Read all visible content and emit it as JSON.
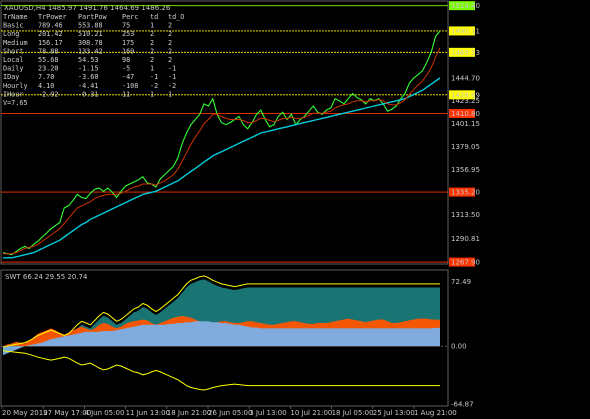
{
  "chart_data": [
    {
      "type": "line",
      "title": "XAUUSD,H4  1485.97 1491.76 1464.69 1486.26",
      "symbol": "XAUUSD,H4",
      "ohlc": {
        "open": "1485.97",
        "high": "1491.76",
        "low": "1464.69",
        "close": "1486.26"
      },
      "ylim": [
        1268,
        1516
      ],
      "y_ticks": [
        "1514.40",
        "1490.11",
        "1469.53",
        "1444.70",
        "1423.25",
        "1401.15",
        "1379.05",
        "1356.95",
        "1335.20",
        "1313.50",
        "1290.81",
        "1267.90"
      ],
      "y_tick_values": [
        1514.4,
        1490.11,
        1469.53,
        1444.7,
        1423.25,
        1401.15,
        1379.05,
        1356.95,
        1335.2,
        1313.5,
        1290.81,
        1267.9
      ],
      "highlighted_levels": [
        {
          "value": 1514.4,
          "label": "1514.40",
          "color": "#7CFC00"
        },
        {
          "value": 1490.11,
          "label": "1490.11",
          "color": "#ffff00"
        },
        {
          "value": 1469.53,
          "label": "1469.53",
          "color": "#ffff00"
        },
        {
          "value": 1428.69,
          "label": "1428.69",
          "color": "#ffff00"
        },
        {
          "value": 1410.8,
          "label": "1410.80",
          "color": "#ff3300"
        },
        {
          "value": 1335.2,
          "label": "1335.20",
          "color": "#ff3300"
        },
        {
          "value": 1267.9,
          "label": "1267.90",
          "color": "#ff3300"
        }
      ],
      "x_ticks": [
        "20 May 2019",
        "27 May 17:00",
        "4 Jun 05:00",
        "11 Jun 13:00",
        "18 Jun 21:00",
        "26 Jun 05:00",
        "3 Jul 13:00",
        "10 Jul 21:00",
        "18 Jul 05:00",
        "25 Jul 13:00",
        "1 Aug 21:00"
      ],
      "series": [
        {
          "values": [
            1277,
            1276,
            1275,
            1278,
            1281,
            1283,
            1281,
            1285,
            1288,
            1292,
            1296,
            1300,
            1303,
            1306,
            1320,
            1322,
            1327,
            1333,
            1330,
            1329,
            1334,
            1338,
            1339,
            1336,
            1339,
            1335,
            1330,
            1336,
            1341,
            1343,
            1345,
            1347,
            1350,
            1344,
            1343,
            1340,
            1348,
            1352,
            1356,
            1360,
            1368,
            1382,
            1392,
            1400,
            1405,
            1410,
            1420,
            1418,
            1425,
            1410,
            1402,
            1400,
            1402,
            1405,
            1408,
            1400,
            1396,
            1402,
            1410,
            1414,
            1405,
            1398,
            1400,
            1408,
            1412,
            1405,
            1410,
            1400,
            1405,
            1408,
            1413,
            1418,
            1412,
            1410,
            1414,
            1416,
            1425,
            1423,
            1420,
            1425,
            1430,
            1426,
            1424,
            1420,
            1425,
            1423,
            1425,
            1420,
            1413,
            1415,
            1418,
            1425,
            1430,
            1440,
            1445,
            1448,
            1452,
            1460,
            1470,
            1485,
            1490
          ]
        },
        {
          "values": [
            1272,
            1272,
            1272,
            1273,
            1274,
            1275,
            1276,
            1277,
            1279,
            1281,
            1283,
            1285,
            1287,
            1289,
            1292,
            1295,
            1298,
            1301,
            1304,
            1306,
            1309,
            1311,
            1313,
            1315,
            1317,
            1319,
            1321,
            1323,
            1325,
            1327,
            1329,
            1331,
            1333,
            1334,
            1335,
            1336,
            1338,
            1340,
            1342,
            1344,
            1346,
            1349,
            1352,
            1355,
            1358,
            1361,
            1364,
            1367,
            1370,
            1372,
            1374,
            1376,
            1378,
            1380,
            1382,
            1384,
            1386,
            1388,
            1390,
            1392,
            1393,
            1394,
            1395,
            1396,
            1397,
            1398,
            1399,
            1400,
            1401,
            1402,
            1403,
            1404,
            1405,
            1406,
            1407,
            1408,
            1409,
            1410,
            1411,
            1412,
            1413,
            1414,
            1415,
            1416,
            1417,
            1418,
            1419,
            1420,
            1421,
            1422,
            1423,
            1424,
            1425,
            1427,
            1429,
            1431,
            1433,
            1436,
            1439,
            1442,
            1445
          ]
        },
        {
          "values": [
            1276,
            1276,
            1276,
            1277,
            1279,
            1281,
            1282,
            1283,
            1285,
            1288,
            1291,
            1294,
            1297,
            1300,
            1305,
            1310,
            1315,
            1320,
            1322,
            1324,
            1326,
            1329,
            1331,
            1332,
            1333,
            1333,
            1333,
            1334,
            1336,
            1338,
            1340,
            1341,
            1343,
            1343,
            1343,
            1342,
            1344,
            1346,
            1349,
            1352,
            1357,
            1365,
            1373,
            1381,
            1388,
            1394,
            1401,
            1405,
            1410,
            1410,
            1408,
            1406,
            1405,
            1405,
            1405,
            1404,
            1402,
            1402,
            1404,
            1406,
            1406,
            1404,
            1403,
            1404,
            1406,
            1406,
            1407,
            1406,
            1406,
            1407,
            1409,
            1411,
            1411,
            1411,
            1412,
            1413,
            1416,
            1418,
            1419,
            1420,
            1422,
            1423,
            1423,
            1422,
            1423,
            1423,
            1424,
            1423,
            1420,
            1419,
            1419,
            1421,
            1424,
            1429,
            1434,
            1438,
            1442,
            1448,
            1455,
            1465,
            1474
          ]
        }
      ]
    },
    {
      "type": "area",
      "title": "SWT 66.24 29.55 20.74",
      "values_text": "SWT 66.24 29.55 20.74",
      "ylim": [
        -65,
        80
      ],
      "y_ticks": [
        "72.49",
        "0.00",
        "-64.87"
      ],
      "y_tick_values": [
        72.49,
        0.0,
        -64.87
      ],
      "series": [
        {
          "values": [
            -5,
            -4,
            -3,
            -2,
            -1,
            0,
            2,
            5,
            8,
            10,
            12,
            14,
            12,
            10,
            8,
            10,
            15,
            20,
            24,
            22,
            20,
            25,
            30,
            34,
            32,
            28,
            24,
            26,
            30,
            34,
            38,
            40,
            44,
            42,
            38,
            35,
            38,
            42,
            46,
            50,
            54,
            60,
            66,
            70,
            72,
            74,
            75,
            73,
            70,
            68,
            66,
            65,
            64,
            63,
            64,
            65,
            66,
            66,
            66,
            66,
            66,
            66,
            66,
            66,
            66,
            66,
            66,
            66,
            66,
            66,
            66,
            66,
            66,
            66,
            66,
            66,
            66,
            66,
            66,
            66,
            66,
            66,
            66,
            66,
            66,
            66,
            66,
            66,
            66,
            66,
            66,
            66,
            66,
            66,
            66,
            66,
            66,
            66,
            66,
            66,
            66
          ]
        },
        {
          "values": [
            0,
            2,
            3,
            5,
            4,
            3,
            6,
            10,
            14,
            16,
            18,
            20,
            18,
            15,
            13,
            15,
            18,
            20,
            22,
            20,
            18,
            20,
            24,
            26,
            25,
            22,
            20,
            22,
            25,
            27,
            28,
            29,
            30,
            29,
            26,
            24,
            26,
            28,
            30,
            32,
            33,
            34,
            33,
            32,
            30,
            28,
            27,
            26,
            26,
            27,
            28,
            28,
            27,
            26,
            26,
            27,
            28,
            28,
            27,
            26,
            25,
            24,
            24,
            25,
            26,
            27,
            28,
            28,
            27,
            26,
            25,
            25,
            26,
            26,
            26,
            27,
            28,
            29,
            30,
            31,
            30,
            29,
            28,
            27,
            28,
            29,
            30,
            30,
            28,
            26,
            26,
            27,
            28,
            29,
            30,
            31,
            31,
            31,
            30,
            30,
            29.55
          ]
        },
        {
          "values": [
            -10,
            -8,
            -6,
            -4,
            -2,
            0,
            1,
            2,
            3,
            4,
            6,
            8,
            9,
            10,
            11,
            12,
            13,
            14,
            15,
            16,
            16,
            16,
            16,
            17,
            17,
            17,
            18,
            19,
            20,
            21,
            22,
            23,
            24,
            24,
            24,
            24,
            24,
            24,
            25,
            25,
            26,
            26,
            27,
            27,
            28,
            28,
            28,
            28,
            27,
            27,
            26,
            26,
            25,
            24,
            24,
            23,
            22,
            21,
            21,
            20,
            20,
            20,
            20,
            20,
            20,
            20,
            20,
            20,
            20,
            20,
            20,
            20,
            20,
            20,
            20,
            20,
            20,
            20,
            20,
            20,
            20,
            20,
            20,
            20,
            20,
            20,
            20,
            20,
            20,
            20,
            20,
            20,
            20,
            20,
            20,
            20,
            20,
            20,
            20,
            20.5,
            20.74
          ]
        }
      ]
    }
  ],
  "table": {
    "headers": [
      "TrName",
      "TrPower",
      "PartPow",
      "Perc",
      "td",
      "td_O"
    ],
    "rows": [
      [
        "Basic",
        "789.46",
        "553.88",
        "75",
        "1",
        "2"
      ],
      [
        "Long",
        "201.42",
        "510.21",
        "253",
        "2",
        "2"
      ],
      [
        "Medium",
        "156.17",
        "308.78",
        "175",
        "2",
        "2"
      ],
      [
        "Short",
        "78.88",
        "133.42",
        "169",
        "2",
        "2"
      ],
      [
        "Local",
        "55.68",
        "54.53",
        "98",
        "2",
        "2"
      ],
      [
        "Daily",
        "23.20",
        "-1.15",
        "-5",
        "1",
        "-1"
      ],
      [
        "IDay",
        "7.70",
        "-3.60",
        "-47",
        "-1",
        "-1"
      ],
      [
        "Hourly",
        "4.10",
        "-4.41",
        "-108",
        "-2",
        "-2"
      ],
      [
        "IHour",
        "-2.92",
        "-0.31",
        "11",
        "1",
        "1"
      ]
    ],
    "footer": "V=7.65"
  },
  "colors": {
    "background": "#000000",
    "price": "#33ff33",
    "fast_ma": "#00ccdd",
    "slow_ma": "#cc3300",
    "band": "#ffff00",
    "orange_fill": "#ff5500",
    "teal_fill": "#1a7a7a",
    "blue_fill": "#7ab0e8"
  }
}
